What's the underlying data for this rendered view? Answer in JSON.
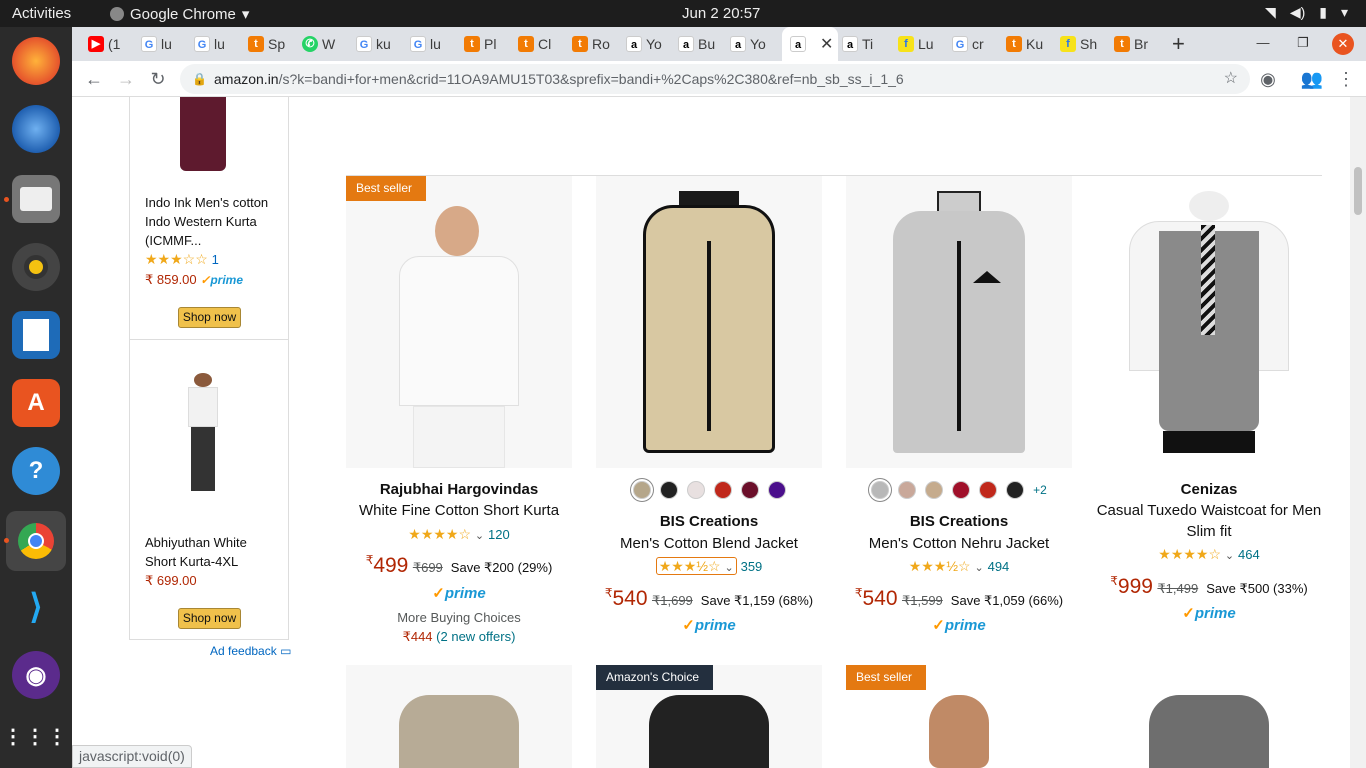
{
  "topbar": {
    "activities": "Activities",
    "app": "Google Chrome",
    "clock": "Jun 2  20:57"
  },
  "tabs": [
    "(1",
    "lu",
    "lu",
    "Sp",
    "W",
    "ku",
    "lu",
    "Pl",
    "Cl",
    "Ro",
    "Yo",
    "Bu",
    "Yo",
    "",
    "Ti",
    "Lu",
    "cr",
    "Ku",
    "Sh",
    "Br"
  ],
  "address": {
    "url_domain": "amazon.in",
    "url_rest": "/s?k=bandi+for+men&crid=11OA9AMU15T03&sprefix=bandi+%2Caps%2C380&ref=nb_sb_ss_i_1_6"
  },
  "sidebar_ads": [
    {
      "title": "Indo Ink Men's cotton Indo Western Kurta (ICMMF...",
      "rating_count": "1",
      "price": "₹ 859.00",
      "prime": "prime",
      "button": "Shop now"
    },
    {
      "title": "Abhiyuthan White Short Kurta-4XL",
      "price": "₹ 699.00",
      "button": "Shop now"
    }
  ],
  "ad_feedback": "Ad feedback",
  "products": [
    {
      "badge": "Best seller",
      "brand": "Rajubhai Hargovindas",
      "title": "White Fine Cotton Short Kurta",
      "rating": 4.0,
      "rating_count": "120",
      "price": "499",
      "mrp": "₹699",
      "save": "Save ₹200 (29%)",
      "prime": "prime",
      "more": "More Buying Choices",
      "offer_price": "₹444",
      "offer_link": "(2 new offers)"
    },
    {
      "brand": "BIS Creations",
      "title": "Men's Cotton Blend Jacket",
      "rating": 3.5,
      "rating_count": "359",
      "price": "540",
      "mrp": "₹1,699",
      "save": "Save ₹1,159 (68%)",
      "prime": "prime",
      "swatches": [
        "#b5a68a",
        "#222222",
        "#e8e0e0",
        "#c0281b",
        "#6b0f2a",
        "#4b0f8c"
      ]
    },
    {
      "brand": "BIS Creations",
      "title": "Men's Cotton Nehru Jacket",
      "rating": 3.5,
      "rating_count": "494",
      "price": "540",
      "mrp": "₹1,599",
      "save": "Save ₹1,059 (66%)",
      "prime": "prime",
      "swatches": [
        "#b8b8b8",
        "#c9a89a",
        "#c5ab8d",
        "#a0102a",
        "#c0281b",
        "#222222"
      ],
      "swatch_more": "+2"
    },
    {
      "brand": "Cenizas",
      "title": "Casual Tuxedo Waistcoat for Men Slim fit",
      "rating": 4.0,
      "rating_count": "464",
      "price": "999",
      "mrp": "₹1,499",
      "save": "Save ₹500 (33%)",
      "prime": "prime"
    }
  ],
  "row2_badges": [
    "",
    "Amazon's Choice",
    "Best seller",
    ""
  ],
  "status": "javascript:void(0)",
  "colors": {
    "price": "#b12704",
    "link": "#007185",
    "prime": "#1a98d5",
    "best_seller": "#e47911",
    "ubuntu_accent": "#e95420"
  }
}
